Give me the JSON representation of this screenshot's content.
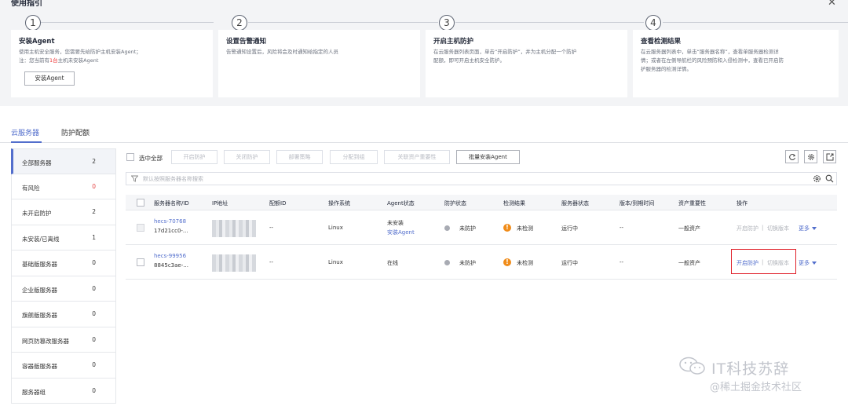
{
  "guide": {
    "title": "使用指引",
    "steps": [
      {
        "num": "1",
        "title": "安装Agent",
        "desc1": "使用主机安全服务，您需要先给防护主机安装Agent；",
        "desc2_pre": "注：您当前有",
        "desc2_hl": "1台",
        "desc2_post": "主机未安装Agent",
        "button": "安装Agent"
      },
      {
        "num": "2",
        "title": "设置告警通知",
        "desc1": "告警通知设置后，风险将会及时通知给指定的人员"
      },
      {
        "num": "3",
        "title": "开启主机防护",
        "desc1": "在云服务器列表页面，单击“开启防护”，并为主机分配一个防护",
        "desc2": "配额，即可开启主机安全防护。"
      },
      {
        "num": "4",
        "title": "查看检测结果",
        "desc1": "在云服务器列表中，单击“服务器名称”，查看单服务器检测详",
        "desc2": "情；或者在左侧导航栏的风险预防和入侵检测中，查看已开启防",
        "desc3": "护服务器的检测详情。"
      }
    ]
  },
  "tabs": [
    {
      "label": "云服务器",
      "active": true
    },
    {
      "label": "防护配额",
      "active": false
    }
  ],
  "sidebar": {
    "items": [
      {
        "label": "全部服务器",
        "count": "2"
      },
      {
        "label": "有风险",
        "count": "0"
      },
      {
        "label": "未开启防护",
        "count": "2"
      },
      {
        "label": "未安装/已离线",
        "count": "1"
      },
      {
        "label": "基础版服务器",
        "count": "0"
      },
      {
        "label": "企业版服务器",
        "count": "0"
      },
      {
        "label": "旗舰版服务器",
        "count": "0"
      },
      {
        "label": "网页防篡改服务器",
        "count": "0"
      },
      {
        "label": "容器版服务器",
        "count": "0"
      },
      {
        "label": "服务器组",
        "count": "0"
      }
    ]
  },
  "toolbar": {
    "select_all": "选中全部",
    "buttons": [
      "开启防护",
      "关闭防护",
      "部署策略",
      "分配到组",
      "关联资产重要性",
      "批量安装Agent"
    ],
    "search_placeholder": "默认按照服务器名称搜索"
  },
  "table": {
    "headers": [
      "服务器名称/ID",
      "IP地址",
      "配额ID",
      "操作系统",
      "Agent状态",
      "防护状态",
      "检测结果",
      "服务器状态",
      "版本/到期时间",
      "资产重要性",
      "操作"
    ],
    "rows": [
      {
        "name": "hecs-70768",
        "id": "17d21cc0-...",
        "quota": "--",
        "os": "Linux",
        "agent": "未安装",
        "agent_action": "安装Agent",
        "protect": "未防护",
        "result": "未检测",
        "status": "运行中",
        "version": "--",
        "importance": "一般资产",
        "op_enable": "开启防护",
        "op_switch": "切换版本",
        "op_more": "更多"
      },
      {
        "name": "hecs-99956",
        "id": "8845c3ae-...",
        "quota": "--",
        "os": "Linux",
        "agent": "在线",
        "agent_action": "",
        "protect": "未防护",
        "result": "未检测",
        "status": "运行中",
        "version": "--",
        "importance": "一般资产",
        "op_enable": "开启防护",
        "op_switch": "切换版本",
        "op_more": "更多"
      }
    ]
  },
  "watermark": {
    "line1": "IT科技苏辞",
    "line2": "@稀土掘金技术社区"
  },
  "colors": {
    "accent": "#526ecc",
    "warning": "#f08c1a",
    "danger": "#e0202a"
  }
}
